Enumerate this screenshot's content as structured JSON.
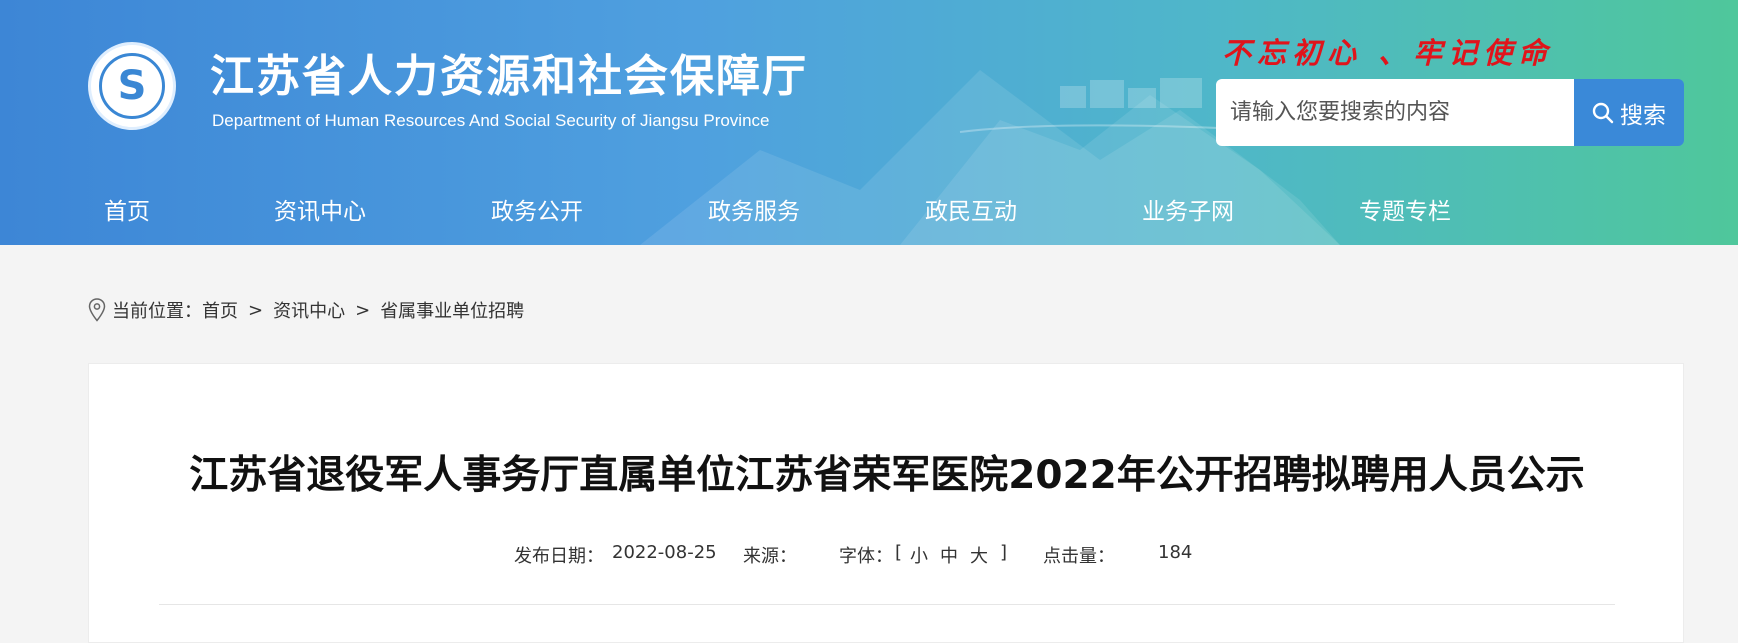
{
  "header": {
    "site_title": "江苏省人力资源和社会保障厅",
    "site_subtitle": "Department of Human Resources And Social Security of Jiangsu Province",
    "slogan": "不忘初心 、牢记使命",
    "search_placeholder": "请输入您要搜索的内容",
    "search_button": "搜索"
  },
  "nav": {
    "items": [
      "首页",
      "资讯中心",
      "政务公开",
      "政务服务",
      "政民互动",
      "业务子网",
      "专题专栏"
    ]
  },
  "breadcrumb": {
    "prefix": "当前位置：",
    "items": [
      "首页",
      "资讯中心",
      "省属事业单位招聘"
    ],
    "separator": ">"
  },
  "article": {
    "title": "江苏省退役军人事务厅直属单位江苏省荣军医院2022年公开招聘拟聘用人员公示",
    "publish_label": "发布日期：",
    "publish_date": "2022-08-25",
    "source_label": "来源：",
    "source_value": "",
    "font_label": "字体：",
    "font_open": "[",
    "font_small": "小",
    "font_medium": "中",
    "font_large": "大",
    "font_close": "]",
    "hits_label": "点击量：",
    "hits_value": "184"
  },
  "colors": {
    "header_start": "#3d86d6",
    "header_end": "#4fc79b",
    "slogan": "#e0141b",
    "search_button": "#3a89d8"
  },
  "icons": {
    "search": "search-icon",
    "location": "location-pin-icon",
    "logo": "logo-emblem"
  }
}
